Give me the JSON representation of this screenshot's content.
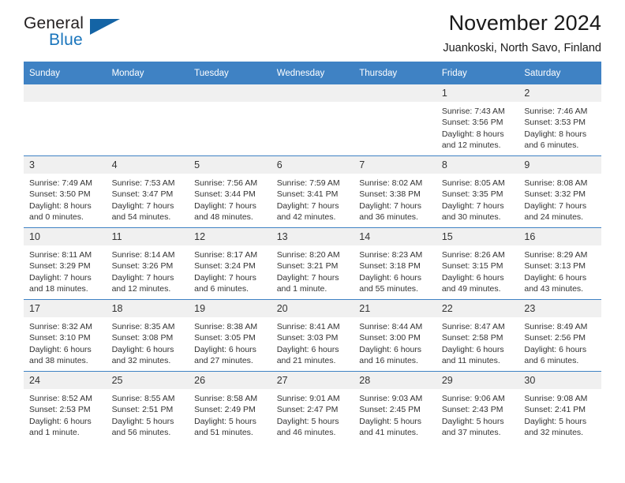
{
  "brand": {
    "name_part1": "General",
    "name_part2": "Blue",
    "triangle_color": "#1464a5",
    "blue_color": "#1a75bc"
  },
  "header": {
    "title": "November 2024",
    "subtitle": "Juankoski, North Savo, Finland"
  },
  "calendar": {
    "header_color": "#3f82c4",
    "daynum_bg": "#f0f0f0",
    "weekdays": [
      "Sunday",
      "Monday",
      "Tuesday",
      "Wednesday",
      "Thursday",
      "Friday",
      "Saturday"
    ],
    "weeks": [
      [
        {
          "day": "",
          "lines": []
        },
        {
          "day": "",
          "lines": []
        },
        {
          "day": "",
          "lines": []
        },
        {
          "day": "",
          "lines": []
        },
        {
          "day": "",
          "lines": []
        },
        {
          "day": "1",
          "lines": [
            "Sunrise: 7:43 AM",
            "Sunset: 3:56 PM",
            "Daylight: 8 hours",
            "and 12 minutes."
          ]
        },
        {
          "day": "2",
          "lines": [
            "Sunrise: 7:46 AM",
            "Sunset: 3:53 PM",
            "Daylight: 8 hours",
            "and 6 minutes."
          ]
        }
      ],
      [
        {
          "day": "3",
          "lines": [
            "Sunrise: 7:49 AM",
            "Sunset: 3:50 PM",
            "Daylight: 8 hours",
            "and 0 minutes."
          ]
        },
        {
          "day": "4",
          "lines": [
            "Sunrise: 7:53 AM",
            "Sunset: 3:47 PM",
            "Daylight: 7 hours",
            "and 54 minutes."
          ]
        },
        {
          "day": "5",
          "lines": [
            "Sunrise: 7:56 AM",
            "Sunset: 3:44 PM",
            "Daylight: 7 hours",
            "and 48 minutes."
          ]
        },
        {
          "day": "6",
          "lines": [
            "Sunrise: 7:59 AM",
            "Sunset: 3:41 PM",
            "Daylight: 7 hours",
            "and 42 minutes."
          ]
        },
        {
          "day": "7",
          "lines": [
            "Sunrise: 8:02 AM",
            "Sunset: 3:38 PM",
            "Daylight: 7 hours",
            "and 36 minutes."
          ]
        },
        {
          "day": "8",
          "lines": [
            "Sunrise: 8:05 AM",
            "Sunset: 3:35 PM",
            "Daylight: 7 hours",
            "and 30 minutes."
          ]
        },
        {
          "day": "9",
          "lines": [
            "Sunrise: 8:08 AM",
            "Sunset: 3:32 PM",
            "Daylight: 7 hours",
            "and 24 minutes."
          ]
        }
      ],
      [
        {
          "day": "10",
          "lines": [
            "Sunrise: 8:11 AM",
            "Sunset: 3:29 PM",
            "Daylight: 7 hours",
            "and 18 minutes."
          ]
        },
        {
          "day": "11",
          "lines": [
            "Sunrise: 8:14 AM",
            "Sunset: 3:26 PM",
            "Daylight: 7 hours",
            "and 12 minutes."
          ]
        },
        {
          "day": "12",
          "lines": [
            "Sunrise: 8:17 AM",
            "Sunset: 3:24 PM",
            "Daylight: 7 hours",
            "and 6 minutes."
          ]
        },
        {
          "day": "13",
          "lines": [
            "Sunrise: 8:20 AM",
            "Sunset: 3:21 PM",
            "Daylight: 7 hours",
            "and 1 minute."
          ]
        },
        {
          "day": "14",
          "lines": [
            "Sunrise: 8:23 AM",
            "Sunset: 3:18 PM",
            "Daylight: 6 hours",
            "and 55 minutes."
          ]
        },
        {
          "day": "15",
          "lines": [
            "Sunrise: 8:26 AM",
            "Sunset: 3:15 PM",
            "Daylight: 6 hours",
            "and 49 minutes."
          ]
        },
        {
          "day": "16",
          "lines": [
            "Sunrise: 8:29 AM",
            "Sunset: 3:13 PM",
            "Daylight: 6 hours",
            "and 43 minutes."
          ]
        }
      ],
      [
        {
          "day": "17",
          "lines": [
            "Sunrise: 8:32 AM",
            "Sunset: 3:10 PM",
            "Daylight: 6 hours",
            "and 38 minutes."
          ]
        },
        {
          "day": "18",
          "lines": [
            "Sunrise: 8:35 AM",
            "Sunset: 3:08 PM",
            "Daylight: 6 hours",
            "and 32 minutes."
          ]
        },
        {
          "day": "19",
          "lines": [
            "Sunrise: 8:38 AM",
            "Sunset: 3:05 PM",
            "Daylight: 6 hours",
            "and 27 minutes."
          ]
        },
        {
          "day": "20",
          "lines": [
            "Sunrise: 8:41 AM",
            "Sunset: 3:03 PM",
            "Daylight: 6 hours",
            "and 21 minutes."
          ]
        },
        {
          "day": "21",
          "lines": [
            "Sunrise: 8:44 AM",
            "Sunset: 3:00 PM",
            "Daylight: 6 hours",
            "and 16 minutes."
          ]
        },
        {
          "day": "22",
          "lines": [
            "Sunrise: 8:47 AM",
            "Sunset: 2:58 PM",
            "Daylight: 6 hours",
            "and 11 minutes."
          ]
        },
        {
          "day": "23",
          "lines": [
            "Sunrise: 8:49 AM",
            "Sunset: 2:56 PM",
            "Daylight: 6 hours",
            "and 6 minutes."
          ]
        }
      ],
      [
        {
          "day": "24",
          "lines": [
            "Sunrise: 8:52 AM",
            "Sunset: 2:53 PM",
            "Daylight: 6 hours",
            "and 1 minute."
          ]
        },
        {
          "day": "25",
          "lines": [
            "Sunrise: 8:55 AM",
            "Sunset: 2:51 PM",
            "Daylight: 5 hours",
            "and 56 minutes."
          ]
        },
        {
          "day": "26",
          "lines": [
            "Sunrise: 8:58 AM",
            "Sunset: 2:49 PM",
            "Daylight: 5 hours",
            "and 51 minutes."
          ]
        },
        {
          "day": "27",
          "lines": [
            "Sunrise: 9:01 AM",
            "Sunset: 2:47 PM",
            "Daylight: 5 hours",
            "and 46 minutes."
          ]
        },
        {
          "day": "28",
          "lines": [
            "Sunrise: 9:03 AM",
            "Sunset: 2:45 PM",
            "Daylight: 5 hours",
            "and 41 minutes."
          ]
        },
        {
          "day": "29",
          "lines": [
            "Sunrise: 9:06 AM",
            "Sunset: 2:43 PM",
            "Daylight: 5 hours",
            "and 37 minutes."
          ]
        },
        {
          "day": "30",
          "lines": [
            "Sunrise: 9:08 AM",
            "Sunset: 2:41 PM",
            "Daylight: 5 hours",
            "and 32 minutes."
          ]
        }
      ]
    ]
  }
}
